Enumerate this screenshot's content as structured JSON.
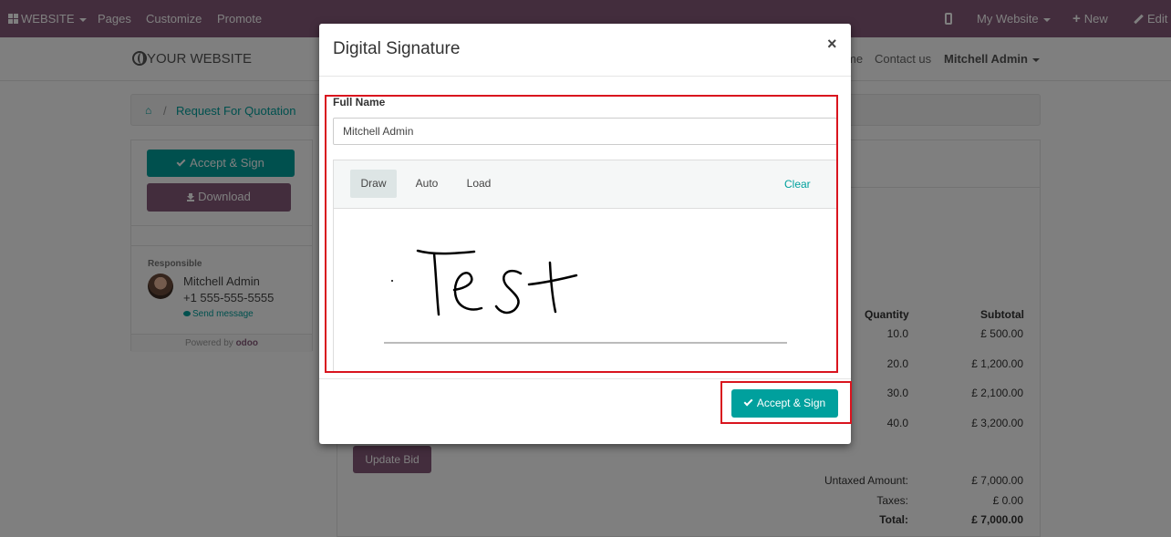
{
  "topbar": {
    "website_menu": "WEBSITE",
    "pages": "Pages",
    "customize": "Customize",
    "promote": "Promote",
    "my_website": "My Website",
    "new": "New",
    "edit": "Edit",
    "bg_color": "#875a7b"
  },
  "header": {
    "logo": "YOUR WEBSITE",
    "nav_partial": "me",
    "contact": "Contact us",
    "user": "Mitchell Admin"
  },
  "breadcrumb": {
    "crumb": "Request For Quotation"
  },
  "sidebar": {
    "accept_sign": "Accept & Sign",
    "download": "Download",
    "responsible_label": "Responsible",
    "responsible_name": "Mitchell Admin",
    "responsible_phone": "+1 555-555-5555",
    "send_message": "Send message",
    "powered_by": "Powered by",
    "odoo": "odoo"
  },
  "table": {
    "col_quantity": "Quantity",
    "col_subtotal": "Subtotal",
    "rows": [
      {
        "qty": "10.0",
        "subtotal": "£ 500.00"
      },
      {
        "qty": "20.0",
        "subtotal": "£ 1,200.00"
      },
      {
        "qty": "30.0",
        "subtotal": "£ 2,100.00"
      },
      {
        "qty": "40.0",
        "subtotal": "£ 3,200.00"
      }
    ],
    "update_bid": "Update Bid",
    "untaxed_label": "Untaxed Amount:",
    "untaxed_value": "£ 7,000.00",
    "taxes_label": "Taxes:",
    "taxes_value": "£ 0.00",
    "total_label": "Total:",
    "total_value": "£ 7,000.00"
  },
  "modal": {
    "title": "Digital Signature",
    "close": "×",
    "full_name_label": "Full Name",
    "full_name_value": "Mitchell Admin",
    "tabs": [
      "Draw",
      "Auto",
      "Load"
    ],
    "active_tab": "Draw",
    "clear": "Clear",
    "accept_sign": "Accept & Sign"
  },
  "colors": {
    "accent": "#00a09d",
    "brand": "#875a7b",
    "highlight": "#d9141e"
  }
}
